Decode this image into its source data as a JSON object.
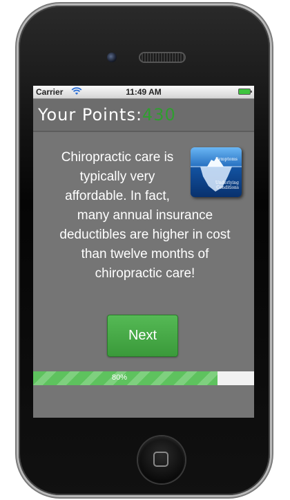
{
  "status_bar": {
    "carrier": "Carrier",
    "time": "11:49 AM"
  },
  "points": {
    "label": "Your Points:",
    "value": "430",
    "value_color": "#2f9e2f"
  },
  "content": {
    "text": "Chiropractic care is typically very affordable. In fact, many annual insurance deductibles are higher in cost than twelve months of chiropractic care!",
    "image": {
      "label_top": "Symptoms",
      "label_bottom_1": "Underlying",
      "label_bottom_2": "Conditions",
      "icon": "iceberg-image"
    }
  },
  "next_button": {
    "label": "Next",
    "color": "#4aaa4a"
  },
  "progress": {
    "percent": 80,
    "label": "80%"
  }
}
